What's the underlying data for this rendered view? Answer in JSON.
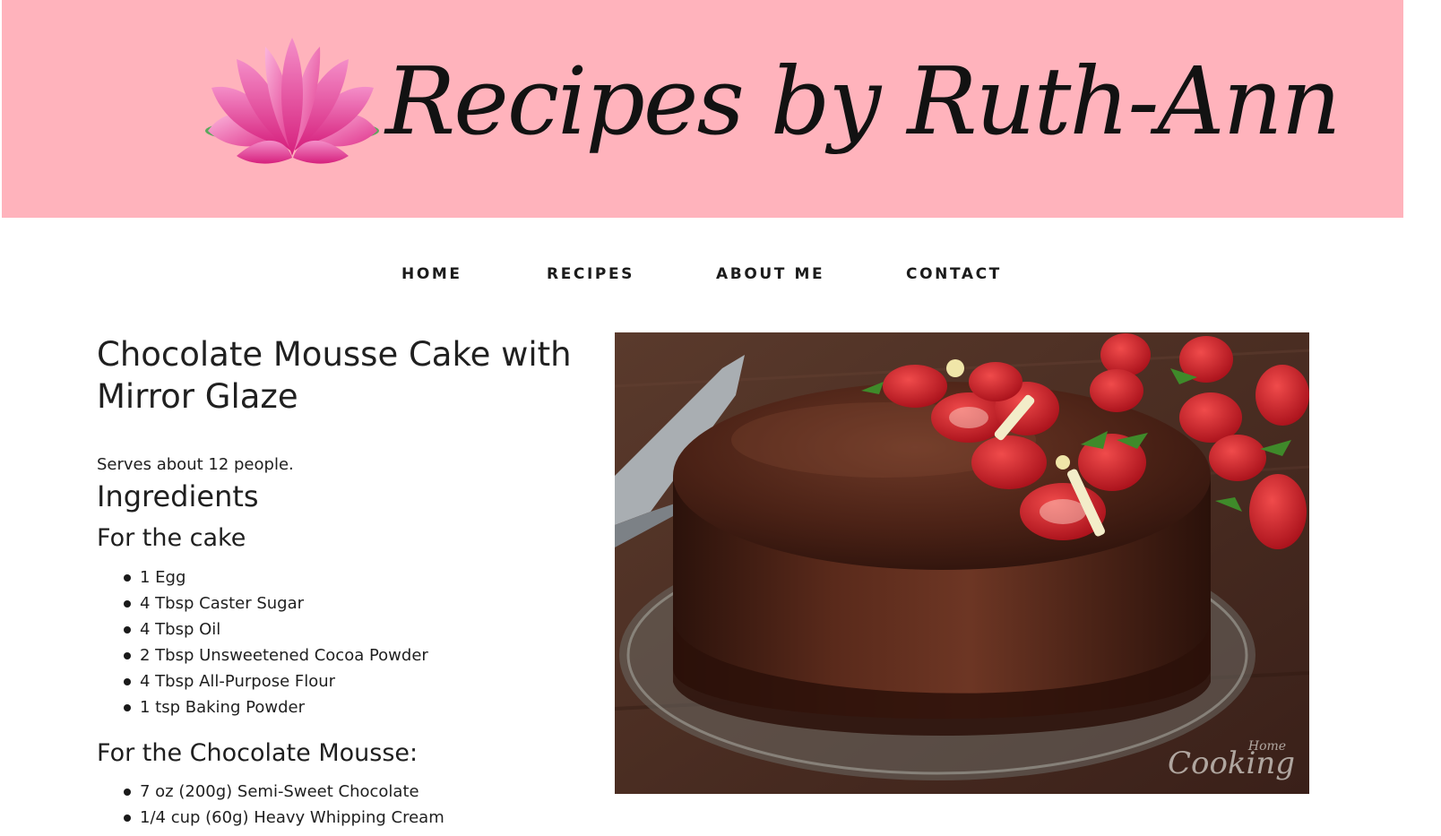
{
  "header": {
    "site_title": "Recipes by Ruth-Ann",
    "background": "#ffb3bc"
  },
  "nav": {
    "items": [
      "HOME",
      "RECIPES",
      "ABOUT ME",
      "CONTACT"
    ]
  },
  "recipe": {
    "title": "Chocolate Mousse Cake with Mirror Glaze",
    "serves": "Serves about 12 people.",
    "ingredients_heading": "Ingredients",
    "sections": [
      {
        "heading": "For the cake",
        "items": [
          "1 Egg",
          "4 Tbsp Caster Sugar",
          "4 Tbsp Oil",
          "2 Tbsp Unsweetened Cocoa Powder",
          "4 Tbsp All-Purpose Flour",
          "1 tsp Baking Powder"
        ]
      },
      {
        "heading": "For the Chocolate Mousse:",
        "items": [
          "7 oz (200g) Semi-Sweet Chocolate",
          "1/4 cup (60g) Heavy Whipping Cream"
        ]
      }
    ],
    "photo_watermark": "Cooking",
    "photo_watermark_small": "Home"
  }
}
